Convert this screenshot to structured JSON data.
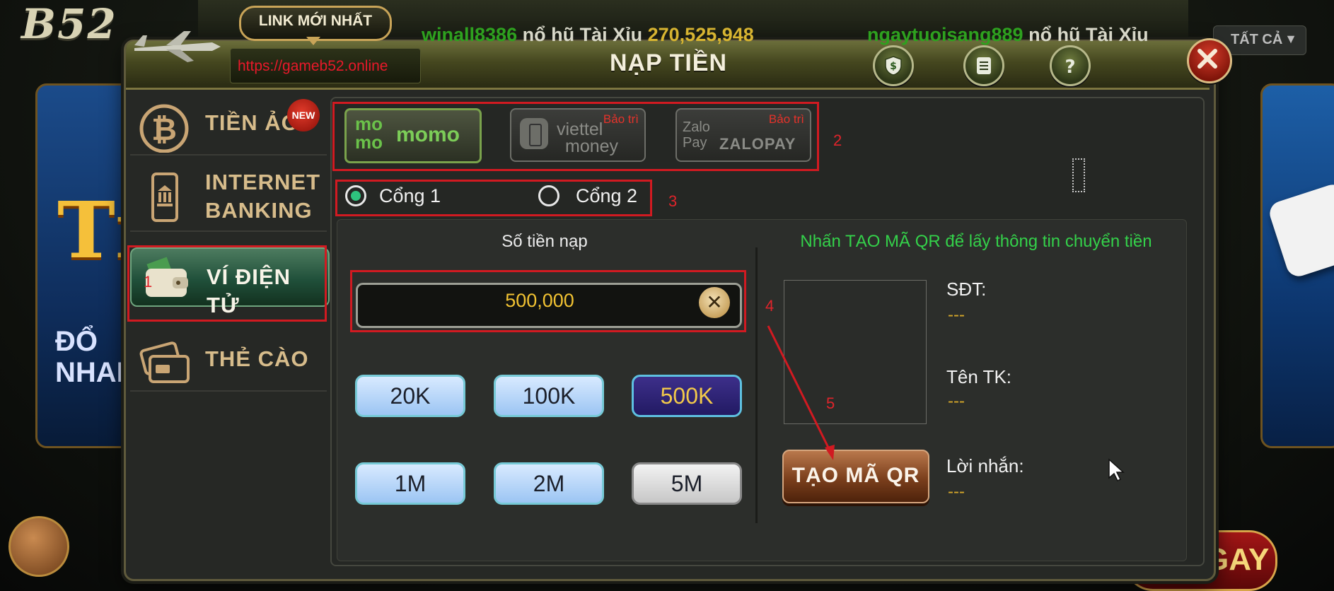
{
  "background": {
    "logo": "B52",
    "left_card_big": "Tiề",
    "left_card_text_1": "ĐỔ",
    "left_card_text_2": "NHAN",
    "filter_select": "TẤT CẢ",
    "bottom_badge": "GAY",
    "ticker": [
      {
        "user": "winall8386",
        "action": "nổ hũ Tài Xỉu",
        "amount": "270,525,948"
      },
      {
        "user": "ngaytuoisang889",
        "action": "nổ hũ Tài Xỉu",
        "amount": ""
      }
    ]
  },
  "header": {
    "title": "NẠP TIỀN",
    "link_badge": "LINK MỚI NHẤT",
    "url": "https://gameb52.online"
  },
  "sidebar": {
    "items": [
      {
        "label": "TIỀN ẢO",
        "badge": "NEW",
        "icon": "bitcoin-icon"
      },
      {
        "label_line1": "INTERNET",
        "label_line2": "BANKING",
        "icon": "mobile-bank-icon"
      },
      {
        "label": "VÍ ĐIỆN TỬ",
        "icon": "wallet-icon",
        "active": true
      },
      {
        "label": "THẺ CÀO",
        "icon": "card-icon"
      }
    ]
  },
  "providers": [
    {
      "name": "momo",
      "logo_top": "mo",
      "logo_bottom": "mo",
      "status": ""
    },
    {
      "name": "viettel money",
      "line1": "viettel",
      "line2": "money",
      "status": "Bảo trì"
    },
    {
      "name": "ZaloPay",
      "prefix1": "Zalo",
      "prefix2": "Pay",
      "label": "ZALOPAY",
      "status": "Bảo trì"
    }
  ],
  "gateways": [
    {
      "label": "Cổng 1",
      "selected": true
    },
    {
      "label": "Cổng 2",
      "selected": false
    }
  ],
  "amount": {
    "title": "Số tiền nạp",
    "value": "500,000"
  },
  "chips": [
    "20K",
    "100K",
    "500K",
    "1M",
    "2M",
    "5M"
  ],
  "selected_chip": "500K",
  "qr": {
    "hint": "Nhấn TẠO MÃ QR để lấy thông tin chuyển tiền",
    "button": "TẠO MÃ QR",
    "fields": [
      {
        "label": "SĐT:",
        "value": "---"
      },
      {
        "label": "Tên TK:",
        "value": "---"
      },
      {
        "label": "Lời nhắn:",
        "value": "---"
      }
    ]
  },
  "annotations": [
    "1",
    "2",
    "3",
    "4",
    "5"
  ],
  "colors": {
    "annotation": "#d11a21",
    "accent_green": "#34d14a",
    "amount_yellow": "#f1c232",
    "maintenance_red": "#e5322a"
  }
}
